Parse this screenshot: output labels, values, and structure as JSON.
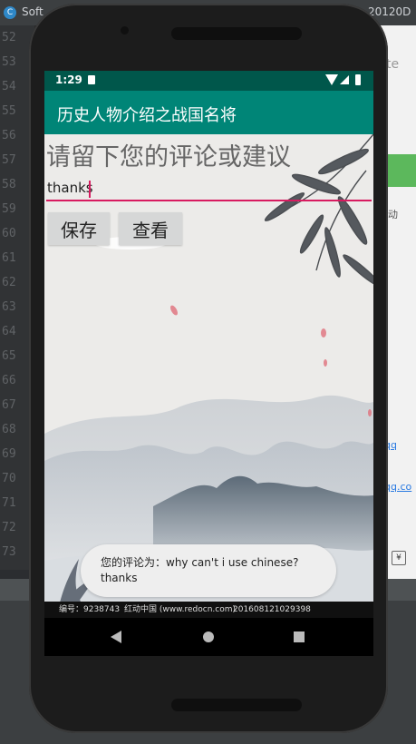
{
  "ide": {
    "app_title": "Soft",
    "file_id": "20120D",
    "line_numbers": [
      "52",
      "53",
      "54",
      "55",
      "56",
      "57",
      "58",
      "59",
      "60",
      "61",
      "62",
      "63",
      "64",
      "65",
      "66",
      "67",
      "68",
      "69",
      "70",
      "71",
      "72",
      "73"
    ],
    "right_panel": {
      "text1": "te",
      "text2": "动",
      "link1": "qq",
      "link2": "qq.co"
    }
  },
  "status_bar": {
    "time": "1:29"
  },
  "app_bar": {
    "title": "历史人物介绍之战国名将"
  },
  "form": {
    "prompt": "请留下您的评论或建议",
    "input_value": "thanks",
    "save_label": "保存",
    "view_label": "查看"
  },
  "toast": {
    "line1": "您的评论为：why can't i use chinese?",
    "line2": "thanks"
  },
  "credit": {
    "id_text": "编号：9238743",
    "site_text": "红动中国 (www.redocn.com)",
    "code_text": "201608121029398"
  },
  "colors": {
    "status_bar": "#00574b",
    "app_bar": "#008577",
    "accent": "#d81b60"
  }
}
